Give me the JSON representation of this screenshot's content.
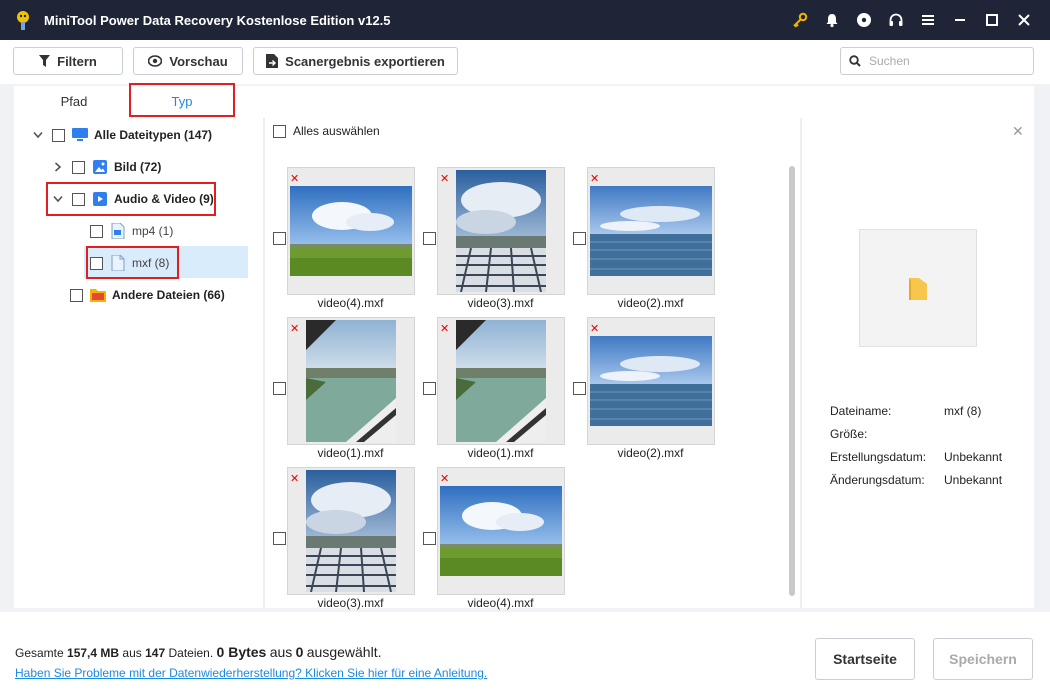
{
  "app": {
    "title": "MiniTool Power Data Recovery Kostenlose Edition v12.5"
  },
  "toolbar": {
    "filter_label": "Filtern",
    "preview_label": "Vorschau",
    "export_label": "Scanergebnis exportieren",
    "search_placeholder": "Suchen"
  },
  "tabs": [
    {
      "label": "Pfad",
      "active": false
    },
    {
      "label": "Typ",
      "active": true
    }
  ],
  "tree": {
    "all": "Alle Dateitypen (147)",
    "image": "Bild (72)",
    "audio_video": "Audio & Video (9)",
    "mp4": "mp4 (1)",
    "mxf": "mxf (8)",
    "other": "Andere Dateien (66)"
  },
  "grid": {
    "select_all": "Alles auswählen",
    "items": [
      {
        "name": "video(4).mxf",
        "scene": "field"
      },
      {
        "name": "video(3).mxf",
        "scene": "panels"
      },
      {
        "name": "video(2).mxf",
        "scene": "sea"
      },
      {
        "name": "video(1).mxf",
        "scene": "lake"
      },
      {
        "name": "video(1).mxf",
        "scene": "lake"
      },
      {
        "name": "video(2).mxf",
        "scene": "sea"
      },
      {
        "name": "video(3).mxf",
        "scene": "panels"
      },
      {
        "name": "video(4).mxf",
        "scene": "field"
      }
    ]
  },
  "preview": {
    "labels": {
      "filename": "Dateiname:",
      "size": "Größe:",
      "created": "Erstellungsdatum:",
      "modified": "Änderungsdatum:"
    },
    "values": {
      "filename": "mxf (8)",
      "size": "",
      "created": "Unbekannt",
      "modified": "Unbekannt"
    }
  },
  "footer": {
    "summary_prefix": "Gesamte",
    "total_size": "157,4 MB",
    "summary_mid": "aus",
    "total_files": "147",
    "summary_files": "Dateien.",
    "selected_size": "0 Bytes",
    "summary_mid2": "aus",
    "selected_count": "0",
    "summary_suffix": "ausgewählt.",
    "help_link": "Haben Sie Probleme mit der Datenwiederherstellung? Klicken Sie hier für eine Anleitung.",
    "home_button": "Startseite",
    "save_button": "Speichern"
  },
  "colors": {
    "titlebar": "#1f2537",
    "accent": "#1a8ae6",
    "highlight": "#e02020",
    "selection": "#d9ecfb"
  }
}
